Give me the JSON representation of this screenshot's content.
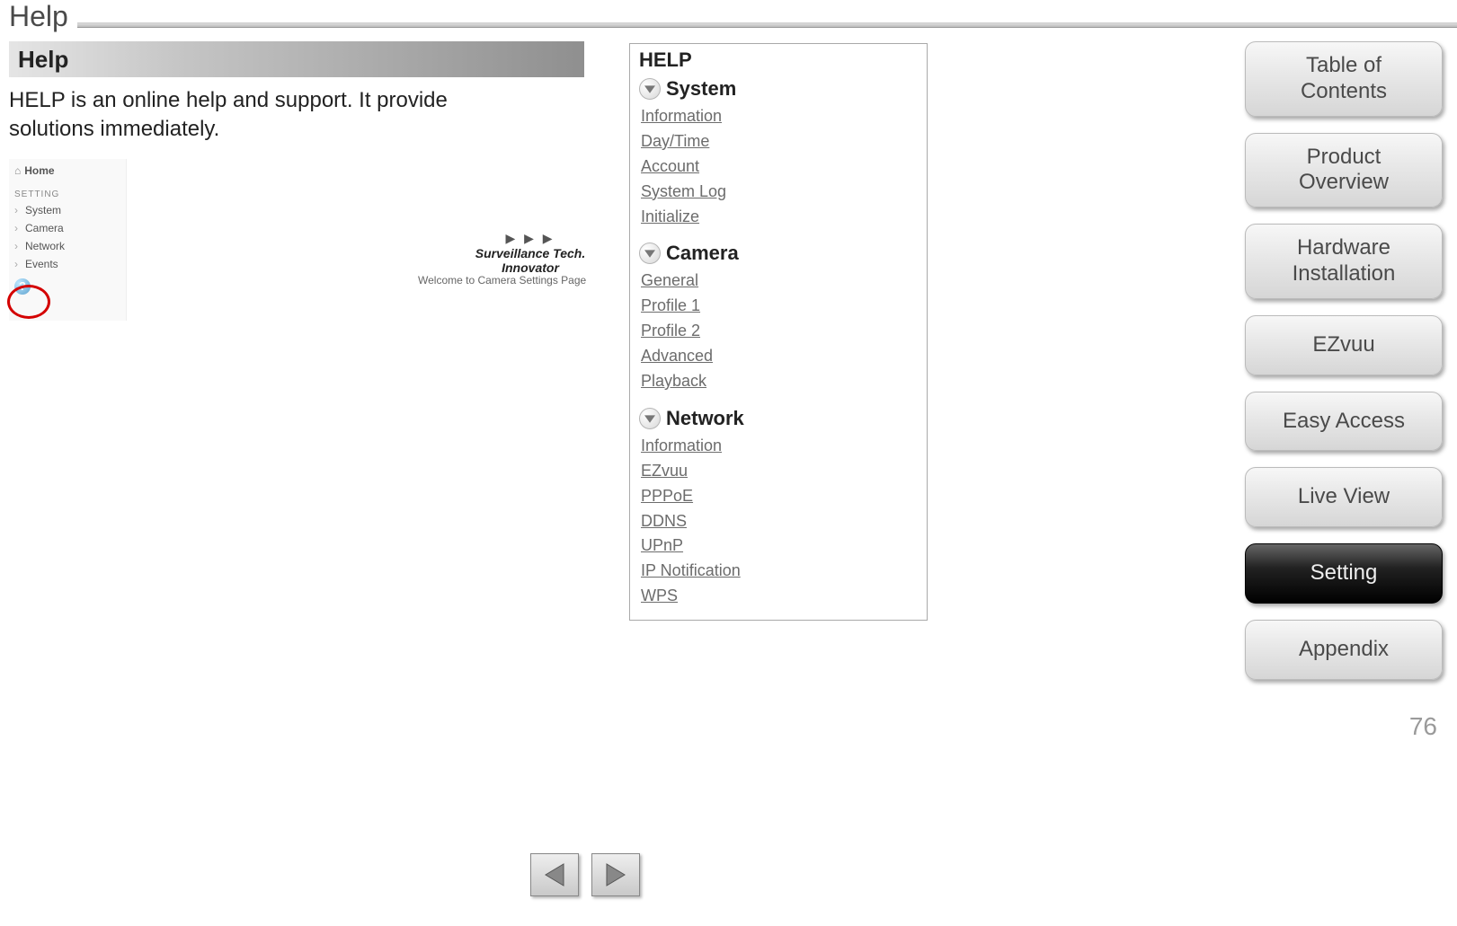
{
  "page": {
    "title": "Help",
    "number": "76"
  },
  "nav": {
    "items": [
      {
        "label": "Table of\nContents",
        "active": false
      },
      {
        "label": "Product\nOverview",
        "active": false
      },
      {
        "label": "Hardware\nInstallation",
        "active": false
      },
      {
        "label": "EZvuu",
        "active": false
      },
      {
        "label": "Easy Access",
        "active": false
      },
      {
        "label": "Live View",
        "active": false
      },
      {
        "label": "Setting",
        "active": true
      },
      {
        "label": "Appendix",
        "active": false
      }
    ]
  },
  "left": {
    "heading": "Help",
    "description": "HELP is an online help and support. It provide solutions immediately.",
    "inset": {
      "home": "Home",
      "setting_label": "SETTING",
      "items": [
        "System",
        "Camera",
        "Network",
        "Events"
      ],
      "brand_tag": "Surveillance Tech. Innovator",
      "welcome": "Welcome to Camera Settings Page"
    }
  },
  "help_panel": {
    "title": "HELP",
    "sections": [
      {
        "name": "System",
        "links": [
          "Information",
          "Day/Time",
          "Account",
          "System Log",
          "Initialize"
        ]
      },
      {
        "name": "Camera",
        "links": [
          "General",
          "Profile 1",
          "Profile 2",
          "Advanced",
          "Playback"
        ]
      },
      {
        "name": "Network",
        "links": [
          "Information",
          "EZvuu",
          "PPPoE",
          "DDNS",
          "UPnP",
          "IP Notification",
          "WPS"
        ]
      }
    ]
  }
}
